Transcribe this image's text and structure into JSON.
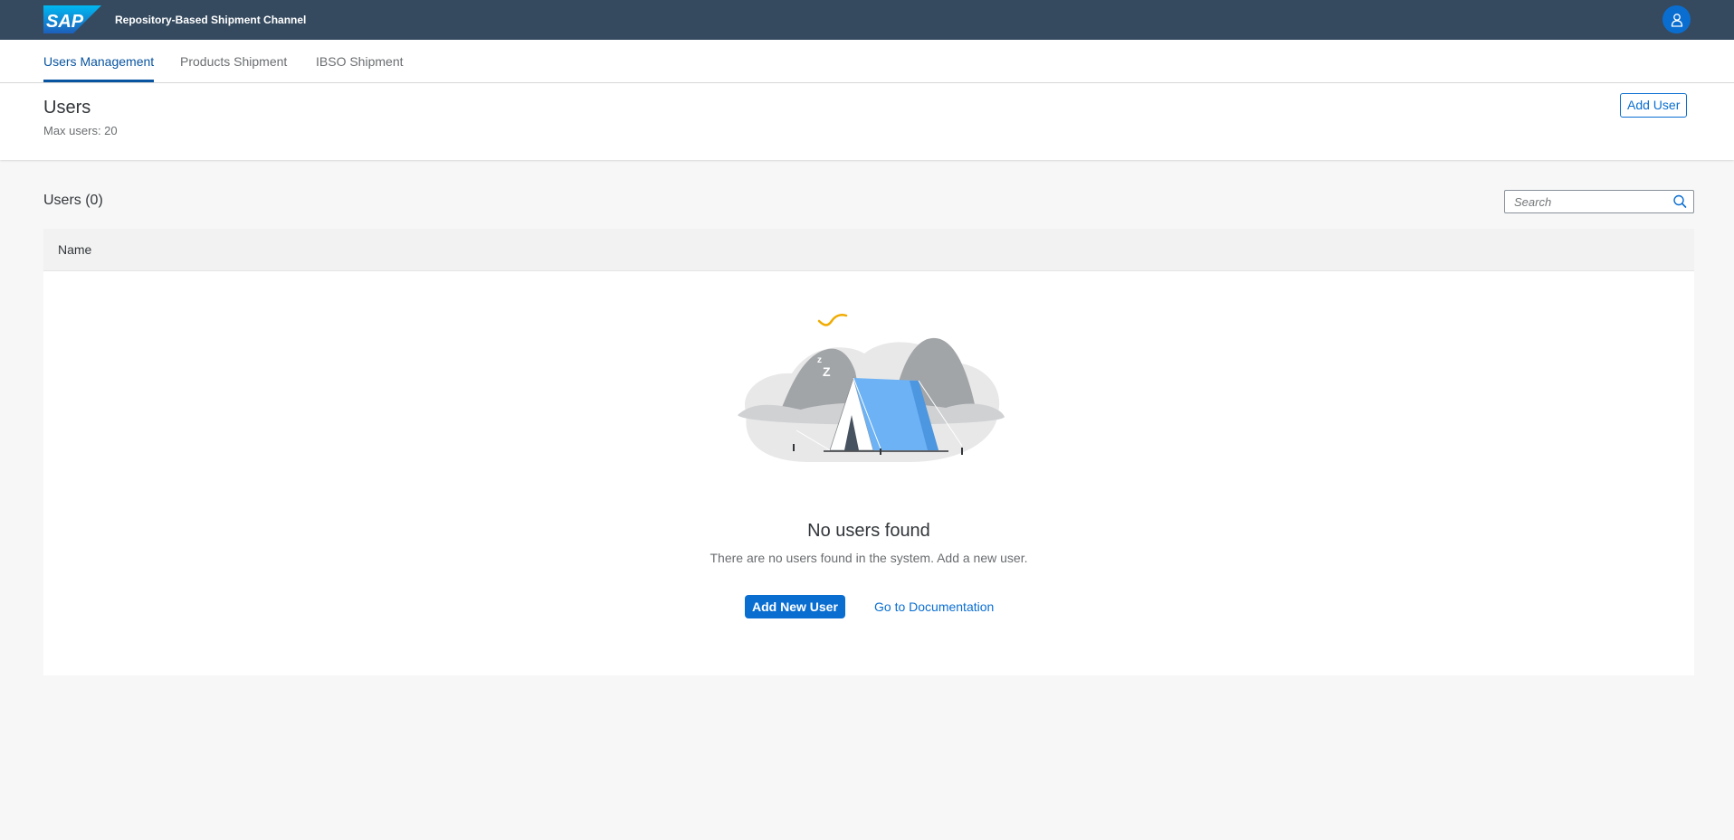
{
  "shell": {
    "logo_text": "SAP",
    "app_title": "Repository-Based Shipment Channel",
    "avatar_icon": "user-icon"
  },
  "tabs": [
    {
      "label": "Users Management",
      "active": true
    },
    {
      "label": "Products Shipment",
      "active": false
    },
    {
      "label": "IBSO Shipment",
      "active": false
    }
  ],
  "header": {
    "title": "Users",
    "subtitle": "Max users: 20",
    "add_user_label": "Add User"
  },
  "table": {
    "title": "Users (0)",
    "search_placeholder": "Search",
    "columns": [
      "Name"
    ],
    "rows": []
  },
  "empty_state": {
    "illustration": "sleeping-tent-illustration",
    "title": "No users found",
    "description": "There are no users found in the system. Add a new user.",
    "primary_action": "Add New User",
    "secondary_action": "Go to Documentation"
  },
  "colors": {
    "shell": "#354a5f",
    "accent": "#0a6ed1",
    "tab_active": "#0854a0",
    "background": "#f7f7f7"
  }
}
